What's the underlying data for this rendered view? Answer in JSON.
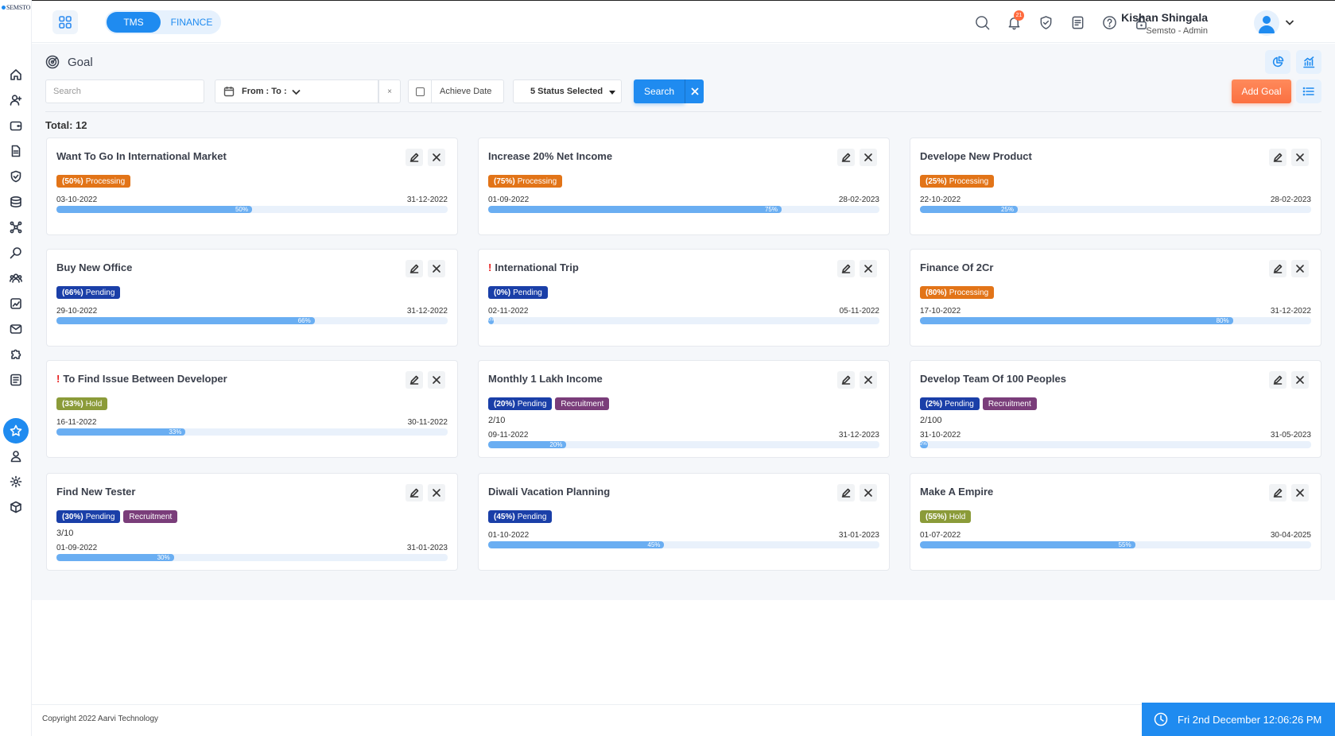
{
  "brand": {
    "logo_text": "SEMSTO"
  },
  "header": {
    "tabs": [
      {
        "label": "TMS"
      },
      {
        "label": "FINANCE"
      }
    ],
    "notification_count": "21",
    "user": {
      "name": "Kishan Shingala",
      "role": "Semsto - Admin"
    }
  },
  "page": {
    "title": "Goal",
    "search_placeholder": "Search",
    "date_range_label": "From : To :",
    "date_clear": "×",
    "achieve_date_label": "Achieve Date",
    "status_label": "5 Status Selected",
    "search_button": "Search",
    "add_goal_button": "Add Goal",
    "total_label": "Total: 12"
  },
  "goals": [
    {
      "title": "Want To Go In International Market",
      "urgent": false,
      "pct": 50,
      "status_pct": "(50%)",
      "status": "Processing",
      "status_type": "processing",
      "tag2": "",
      "ratio": "",
      "start": "03-10-2022",
      "end": "31-12-2022",
      "bar_label": "50%"
    },
    {
      "title": "Increase 20% Net Income",
      "urgent": false,
      "pct": 75,
      "status_pct": "(75%)",
      "status": "Processing",
      "status_type": "processing",
      "tag2": "",
      "ratio": "",
      "start": "01-09-2022",
      "end": "28-02-2023",
      "bar_label": "75%"
    },
    {
      "title": "Develope New Product",
      "urgent": false,
      "pct": 25,
      "status_pct": "(25%)",
      "status": "Processing",
      "status_type": "processing",
      "tag2": "",
      "ratio": "",
      "start": "22-10-2022",
      "end": "28-02-2023",
      "bar_label": "25%"
    },
    {
      "title": "Buy New Office",
      "urgent": false,
      "pct": 66,
      "status_pct": "(66%)",
      "status": "Pending",
      "status_type": "pending",
      "tag2": "",
      "ratio": "",
      "start": "29-10-2022",
      "end": "31-12-2022",
      "bar_label": "66%"
    },
    {
      "title": "International Trip",
      "urgent": true,
      "pct": 0,
      "status_pct": "(0%)",
      "status": "Pending",
      "status_type": "pending",
      "tag2": "",
      "ratio": "",
      "start": "02-11-2022",
      "end": "05-11-2022",
      "bar_label": "0%"
    },
    {
      "title": "Finance Of 2Cr",
      "urgent": false,
      "pct": 80,
      "status_pct": "(80%)",
      "status": "Processing",
      "status_type": "processing",
      "tag2": "",
      "ratio": "",
      "start": "17-10-2022",
      "end": "31-12-2022",
      "bar_label": "80%"
    },
    {
      "title": "To Find Issue Between Developer",
      "urgent": true,
      "pct": 33,
      "status_pct": "(33%)",
      "status": "Hold",
      "status_type": "hold",
      "tag2": "",
      "ratio": "",
      "start": "16-11-2022",
      "end": "30-11-2022",
      "bar_label": "33%"
    },
    {
      "title": "Monthly 1 Lakh Income",
      "urgent": false,
      "pct": 20,
      "status_pct": "(20%)",
      "status": "Pending",
      "status_type": "pending",
      "tag2": "Recruitment",
      "ratio": "2/10",
      "start": "09-11-2022",
      "end": "31-12-2023",
      "bar_label": "20%"
    },
    {
      "title": "Develop Team Of 100 Peoples",
      "urgent": false,
      "pct": 2,
      "status_pct": "(2%)",
      "status": "Pending",
      "status_type": "pending",
      "tag2": "Recruitment",
      "ratio": "2/100",
      "start": "31-10-2022",
      "end": "31-05-2023",
      "bar_label": "2%"
    },
    {
      "title": "Find New Tester",
      "urgent": false,
      "pct": 30,
      "status_pct": "(30%)",
      "status": "Pending",
      "status_type": "pending",
      "tag2": "Recruitment",
      "ratio": "3/10",
      "start": "01-09-2022",
      "end": "31-01-2023",
      "bar_label": "30%"
    },
    {
      "title": "Diwali Vacation Planning",
      "urgent": false,
      "pct": 45,
      "status_pct": "(45%)",
      "status": "Pending",
      "status_type": "pending",
      "tag2": "",
      "ratio": "",
      "start": "01-10-2022",
      "end": "31-01-2023",
      "bar_label": "45%"
    },
    {
      "title": "Make A Empire",
      "urgent": false,
      "pct": 55,
      "status_pct": "(55%)",
      "status": "Hold",
      "status_type": "hold",
      "tag2": "",
      "ratio": "",
      "start": "01-07-2022",
      "end": "30-04-2025",
      "bar_label": "55%"
    }
  ],
  "footer": {
    "copyright": "Copyright 2022 Aarvi Technology",
    "datetime": "Fri 2nd December 12:06:26 PM"
  }
}
